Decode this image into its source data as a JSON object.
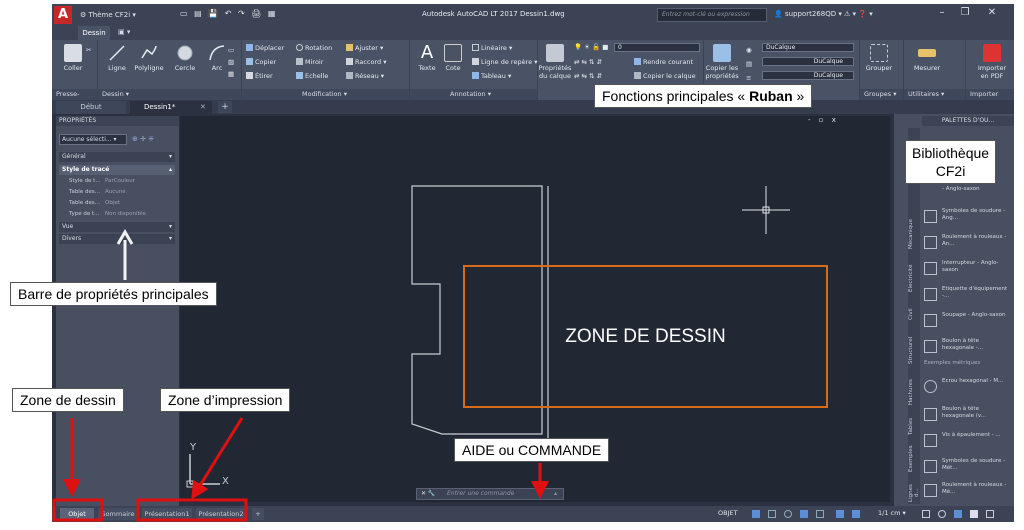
{
  "titlebar": {
    "workspace": "Thème CF2i",
    "title": "Autodesk AutoCAD LT 2017   Dessin1.dwg",
    "search_placeholder": "Entrez mot-clé ou expression",
    "user": "support268QD"
  },
  "ribbon_tabs": [
    "Dessin"
  ],
  "ribbon": {
    "presse_papiers": {
      "label": "Presse-papiers",
      "coller": "Coller"
    },
    "dessin": {
      "label": "Dessin",
      "tools": [
        "Ligne",
        "Polyligne",
        "Cercle",
        "Arc"
      ]
    },
    "modification": {
      "label": "Modification",
      "tools": [
        "Déplacer",
        "Rotation",
        "Ajuster",
        "Copier",
        "Miroir",
        "Raccord",
        "Étirer",
        "Echelle",
        "Réseau"
      ]
    },
    "annotation": {
      "label": "Annotation",
      "texte": "Texte",
      "cote": "Cote",
      "lineaire": "Linéaire",
      "ligne_repere": "Ligne de repère",
      "tableau": "Tableau"
    },
    "calques": {
      "proprietes": "Propriétés du calque",
      "layer_value": "0",
      "rendre_courant": "Rendre courant",
      "copier_calque": "Copier le calque"
    },
    "proprietes": {
      "copier": "Copier les propriétés",
      "values": [
        "DuCalque",
        "DuCalque",
        "DuCalque"
      ]
    },
    "groupes": {
      "label": "Groupes",
      "grouper": "Grouper"
    },
    "utilitaires": {
      "label": "Utilitaires",
      "mesurer": "Mesurer"
    },
    "importer": {
      "label": "Importer",
      "pdf": "Importer en PDF"
    }
  },
  "doc_tabs": {
    "debut": "Début",
    "dessin": "Dessin1*"
  },
  "properties": {
    "title": "PROPRIÉTÉS",
    "selection": "Aucune sélecti...",
    "sections": [
      "Général",
      "Style de tracé",
      "Vue",
      "Divers"
    ],
    "rows": [
      {
        "key": "Style de t...",
        "value": "ParCouleur"
      },
      {
        "key": "Table des...",
        "value": "Aucune"
      },
      {
        "key": "Table des...",
        "value": "Objet"
      },
      {
        "key": "Type de t...",
        "value": "Non disponible"
      }
    ]
  },
  "palette": {
    "title": "PALETTES D'OU...",
    "tabs": [
      "Mécanique",
      "Electricité",
      "Civil",
      "Structurel",
      "Hachures",
      "Tables",
      "Exemples",
      "Lignes d..."
    ],
    "items_top": [
      {
        "label": "- Anglo-saxon"
      },
      {
        "label": "Symboles de soudure - Ang..."
      },
      {
        "label": "Roulement à rouleaux - An..."
      },
      {
        "label": "Interrupteur - Anglo-saxon"
      },
      {
        "label": "Etiquette d'équipement -..."
      },
      {
        "label": "Soupape - Anglo-saxon"
      },
      {
        "label": "Boulon à tête hexagonale -..."
      }
    ],
    "metric_header": "Exemples métriques",
    "items_bottom": [
      {
        "label": "Ecrou hexagonal - M..."
      },
      {
        "label": "Boulon à tête hexagonale (v..."
      },
      {
        "label": "Vis à épaulement - ..."
      },
      {
        "label": "Symboles de soudure - Mét..."
      },
      {
        "label": "Roulement à rouleaux - Mé..."
      }
    ]
  },
  "canvas": {
    "zone_label": "ZONE DE DESSIN",
    "ucs_x": "X",
    "ucs_y": "Y",
    "viewport_controls": "- ▫ x"
  },
  "command": {
    "close": "✕ 🔧",
    "text": "Entrer une commande"
  },
  "layout_tabs": [
    "Objet",
    "Sommaire",
    "Présentation1",
    "Présentation2",
    "+"
  ],
  "status": {
    "mode": "OBJET",
    "scale": "1/1 cm"
  },
  "annotations": {
    "ribbon": "Fonctions principales « Ruban »",
    "ribbon_bold": "Ruban",
    "library_line1": "Bibliothèque",
    "library_line2": "CF2i",
    "properties_bar": "Barre de propriétés principales",
    "zone_dessin": "Zone de dessin",
    "zone_impression": "Zone d’impression",
    "aide": "AIDE ou COMMANDE"
  },
  "colors": {
    "accent_red": "#e01010",
    "zone_orange": "#d86a18"
  }
}
